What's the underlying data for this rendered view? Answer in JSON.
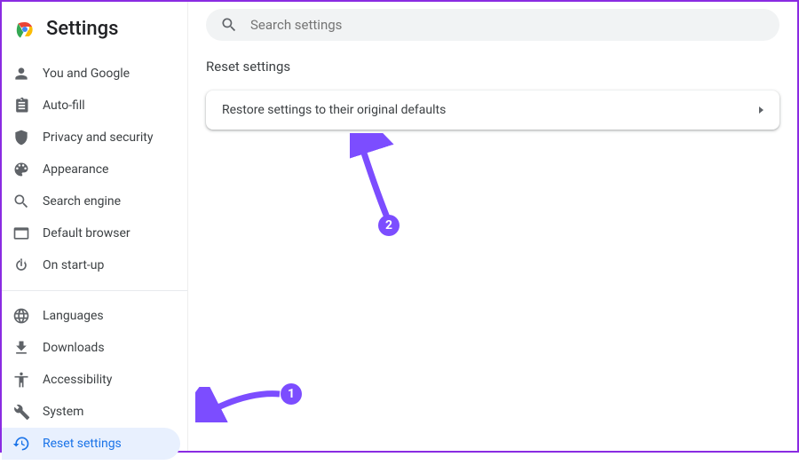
{
  "header": {
    "title": "Settings"
  },
  "search": {
    "placeholder": "Search settings"
  },
  "sidebar": {
    "group1": [
      {
        "label": "You and Google"
      },
      {
        "label": "Auto-fill"
      },
      {
        "label": "Privacy and security"
      },
      {
        "label": "Appearance"
      },
      {
        "label": "Search engine"
      },
      {
        "label": "Default browser"
      },
      {
        "label": "On start-up"
      }
    ],
    "group2": [
      {
        "label": "Languages"
      },
      {
        "label": "Downloads"
      },
      {
        "label": "Accessibility"
      },
      {
        "label": "System"
      },
      {
        "label": "Reset settings"
      }
    ]
  },
  "main": {
    "section_title": "Reset settings",
    "card_label": "Restore settings to their original defaults"
  },
  "annotations": {
    "badge1": "1",
    "badge2": "2",
    "accent": "#7c4dff"
  }
}
